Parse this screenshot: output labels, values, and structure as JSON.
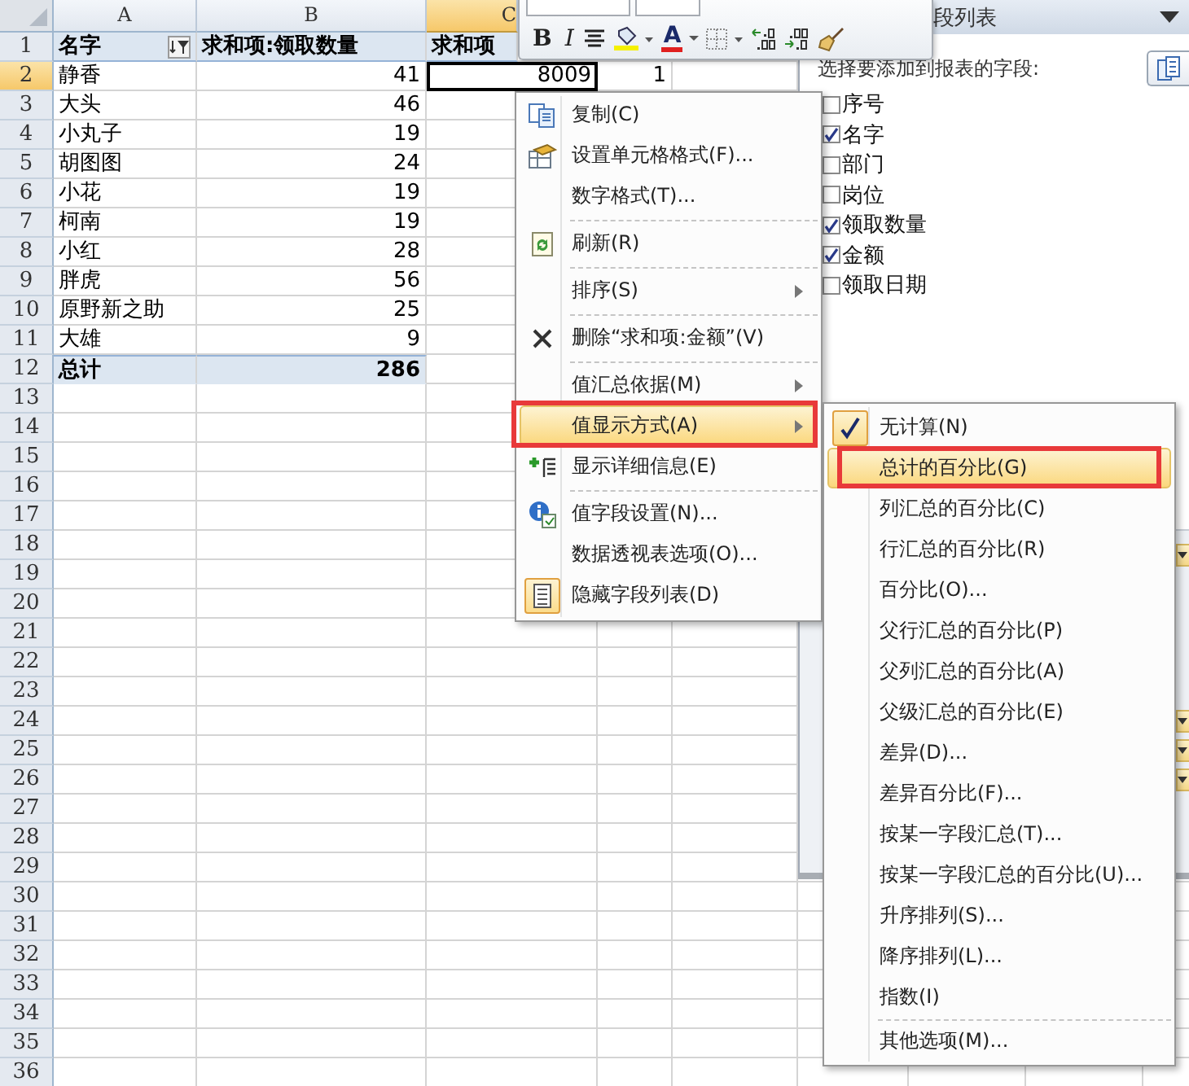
{
  "sheet": {
    "columns": [
      {
        "label": "A",
        "selected": false
      },
      {
        "label": "B",
        "selected": false
      },
      {
        "label": "C",
        "selected": true
      }
    ],
    "rows": [
      {
        "number": "1",
        "kind": "header",
        "selected": false,
        "cells": [
          {
            "text": "名字",
            "selected": false,
            "filter": true
          },
          {
            "text": "求和项:领取数量",
            "selected": false
          },
          {
            "text": "求和项",
            "selected": false
          }
        ]
      },
      {
        "number": "2",
        "kind": "data",
        "selected": true,
        "cells": [
          {
            "text": "静香",
            "selected": false
          },
          {
            "text": "41",
            "selected": false
          },
          {
            "text": "8009",
            "selected": true
          },
          {
            "text": "1",
            "selected": false
          }
        ]
      },
      {
        "number": "3",
        "kind": "data",
        "selected": false,
        "cells": [
          {
            "text": "大头",
            "selected": false
          },
          {
            "text": "46",
            "selected": false
          }
        ]
      },
      {
        "number": "4",
        "kind": "data",
        "selected": false,
        "cells": [
          {
            "text": "小丸子",
            "selected": false
          },
          {
            "text": "19",
            "selected": false
          }
        ]
      },
      {
        "number": "5",
        "kind": "data",
        "selected": false,
        "cells": [
          {
            "text": "胡图图",
            "selected": false
          },
          {
            "text": "24",
            "selected": false
          }
        ]
      },
      {
        "number": "6",
        "kind": "data",
        "selected": false,
        "cells": [
          {
            "text": "小花",
            "selected": false
          },
          {
            "text": "19",
            "selected": false
          }
        ]
      },
      {
        "number": "7",
        "kind": "data",
        "selected": false,
        "cells": [
          {
            "text": "柯南",
            "selected": false
          },
          {
            "text": "19",
            "selected": false
          }
        ]
      },
      {
        "number": "8",
        "kind": "data",
        "selected": false,
        "cells": [
          {
            "text": "小红",
            "selected": false
          },
          {
            "text": "28",
            "selected": false
          }
        ]
      },
      {
        "number": "9",
        "kind": "data",
        "selected": false,
        "cells": [
          {
            "text": "胖虎",
            "selected": false
          },
          {
            "text": "56",
            "selected": false
          }
        ]
      },
      {
        "number": "10",
        "kind": "data",
        "selected": false,
        "cells": [
          {
            "text": "原野新之助",
            "selected": false
          },
          {
            "text": "25",
            "selected": false
          }
        ]
      },
      {
        "number": "11",
        "kind": "data",
        "selected": false,
        "cells": [
          {
            "text": "大雄",
            "selected": false
          },
          {
            "text": "9",
            "selected": false
          }
        ]
      },
      {
        "number": "12",
        "kind": "total",
        "selected": false,
        "cells": [
          {
            "text": "总计",
            "selected": false
          },
          {
            "text": "286",
            "selected": false
          }
        ]
      },
      {
        "number": "13",
        "kind": "empty",
        "selected": false
      },
      {
        "number": "14",
        "kind": "empty",
        "selected": false
      },
      {
        "number": "15",
        "kind": "empty",
        "selected": false
      },
      {
        "number": "16",
        "kind": "empty",
        "selected": false
      },
      {
        "number": "17",
        "kind": "empty",
        "selected": false
      },
      {
        "number": "18",
        "kind": "empty",
        "selected": false
      },
      {
        "number": "19",
        "kind": "empty",
        "selected": false
      },
      {
        "number": "20",
        "kind": "empty",
        "selected": false
      },
      {
        "number": "21",
        "kind": "empty",
        "selected": false
      },
      {
        "number": "22",
        "kind": "empty",
        "selected": false
      },
      {
        "number": "23",
        "kind": "empty",
        "selected": false
      },
      {
        "number": "24",
        "kind": "empty",
        "selected": false
      },
      {
        "number": "25",
        "kind": "empty",
        "selected": false
      },
      {
        "number": "26",
        "kind": "empty",
        "selected": false
      },
      {
        "number": "27",
        "kind": "empty",
        "selected": false
      },
      {
        "number": "28",
        "kind": "empty",
        "selected": false
      },
      {
        "number": "29",
        "kind": "empty",
        "selected": false
      },
      {
        "number": "30",
        "kind": "empty",
        "selected": false
      },
      {
        "number": "31",
        "kind": "empty",
        "selected": false
      },
      {
        "number": "32",
        "kind": "empty",
        "selected": false
      },
      {
        "number": "33",
        "kind": "empty",
        "selected": false
      },
      {
        "number": "34",
        "kind": "empty",
        "selected": false
      },
      {
        "number": "35",
        "kind": "empty",
        "selected": false
      },
      {
        "number": "36",
        "kind": "empty",
        "selected": false
      }
    ]
  },
  "mini_toolbar": {
    "buttons": [
      {
        "kind": "bold",
        "label": "B"
      },
      {
        "kind": "italic",
        "label": "I"
      },
      {
        "kind": "align"
      },
      {
        "kind": "fill"
      },
      {
        "kind": "font-color",
        "label": "A"
      },
      {
        "kind": "borders"
      },
      {
        "kind": "increase-decimal"
      },
      {
        "kind": "decrease-decimal"
      },
      {
        "kind": "format-painter"
      }
    ]
  },
  "field_list": {
    "title": "段列表",
    "prompt": "选择要添加到报表的字段:",
    "fields": [
      {
        "label": "序号",
        "checked": false
      },
      {
        "label": "名字",
        "checked": true
      },
      {
        "label": "部门",
        "checked": false
      },
      {
        "label": "岗位",
        "checked": false
      },
      {
        "label": "领取数量",
        "checked": true
      },
      {
        "label": "金额",
        "checked": true
      },
      {
        "label": "领取日期",
        "checked": false
      }
    ]
  },
  "context_menu": {
    "items": [
      {
        "kind": "item",
        "label": "复制(C)",
        "submenu": false,
        "selected": false,
        "checked": false,
        "annotated": false
      },
      {
        "kind": "item",
        "label": "设置单元格格式(F)...",
        "submenu": false,
        "selected": false,
        "checked": false,
        "annotated": false
      },
      {
        "kind": "item",
        "label": "数字格式(T)...",
        "submenu": false,
        "selected": false,
        "checked": false,
        "annotated": false
      },
      {
        "kind": "separator"
      },
      {
        "kind": "item",
        "label": "刷新(R)",
        "submenu": false,
        "selected": false,
        "checked": false,
        "annotated": false
      },
      {
        "kind": "separator"
      },
      {
        "kind": "item",
        "label": "排序(S)",
        "submenu": true,
        "selected": false,
        "checked": false,
        "annotated": false
      },
      {
        "kind": "separator"
      },
      {
        "kind": "item",
        "label": "删除“求和项:金额”(V)",
        "submenu": false,
        "selected": false,
        "checked": false,
        "annotated": false
      },
      {
        "kind": "separator"
      },
      {
        "kind": "item",
        "label": "值汇总依据(M)",
        "submenu": true,
        "selected": false,
        "checked": false,
        "annotated": false
      },
      {
        "kind": "item",
        "label": "值显示方式(A)",
        "submenu": true,
        "selected": true,
        "checked": false,
        "annotated": true
      },
      {
        "kind": "item",
        "label": "显示详细信息(E)",
        "submenu": false,
        "selected": false,
        "checked": false,
        "annotated": false
      },
      {
        "kind": "separator"
      },
      {
        "kind": "item",
        "label": "值字段设置(N)...",
        "submenu": false,
        "selected": false,
        "checked": false,
        "annotated": false
      },
      {
        "kind": "item",
        "label": "数据透视表选项(O)...",
        "submenu": false,
        "selected": false,
        "checked": false,
        "annotated": false
      },
      {
        "kind": "item",
        "label": "隐藏字段列表(D)",
        "submenu": false,
        "selected": false,
        "checked": true,
        "annotated": false
      }
    ]
  },
  "submenu": {
    "items": [
      {
        "kind": "item",
        "label": "无计算(N)",
        "selected": false,
        "checked": true,
        "annotated": false
      },
      {
        "kind": "item",
        "label": "总计的百分比(G)",
        "selected": true,
        "checked": false,
        "annotated": true
      },
      {
        "kind": "item",
        "label": "列汇总的百分比(C)",
        "selected": false,
        "checked": false,
        "annotated": false
      },
      {
        "kind": "item",
        "label": "行汇总的百分比(R)",
        "selected": false,
        "checked": false,
        "annotated": false
      },
      {
        "kind": "item",
        "label": "百分比(O)...",
        "selected": false,
        "checked": false,
        "annotated": false
      },
      {
        "kind": "item",
        "label": "父行汇总的百分比(P)",
        "selected": false,
        "checked": false,
        "annotated": false
      },
      {
        "kind": "item",
        "label": "父列汇总的百分比(A)",
        "selected": false,
        "checked": false,
        "annotated": false
      },
      {
        "kind": "item",
        "label": "父级汇总的百分比(E)",
        "selected": false,
        "checked": false,
        "annotated": false
      },
      {
        "kind": "item",
        "label": "差异(D)...",
        "selected": false,
        "checked": false,
        "annotated": false
      },
      {
        "kind": "item",
        "label": "差异百分比(F)...",
        "selected": false,
        "checked": false,
        "annotated": false
      },
      {
        "kind": "item",
        "label": "按某一字段汇总(T)...",
        "selected": false,
        "checked": false,
        "annotated": false
      },
      {
        "kind": "item",
        "label": "按某一字段汇总的百分比(U)...",
        "selected": false,
        "checked": false,
        "annotated": false
      },
      {
        "kind": "item",
        "label": "升序排列(S)...",
        "selected": false,
        "checked": false,
        "annotated": false
      },
      {
        "kind": "item",
        "label": "降序排列(L)...",
        "selected": false,
        "checked": false,
        "annotated": false
      },
      {
        "kind": "item",
        "label": "指数(I)",
        "selected": false,
        "checked": false,
        "annotated": false
      },
      {
        "kind": "separator"
      },
      {
        "kind": "item",
        "label": "其他选项(M)...",
        "selected": false,
        "checked": false,
        "annotated": false
      }
    ]
  }
}
